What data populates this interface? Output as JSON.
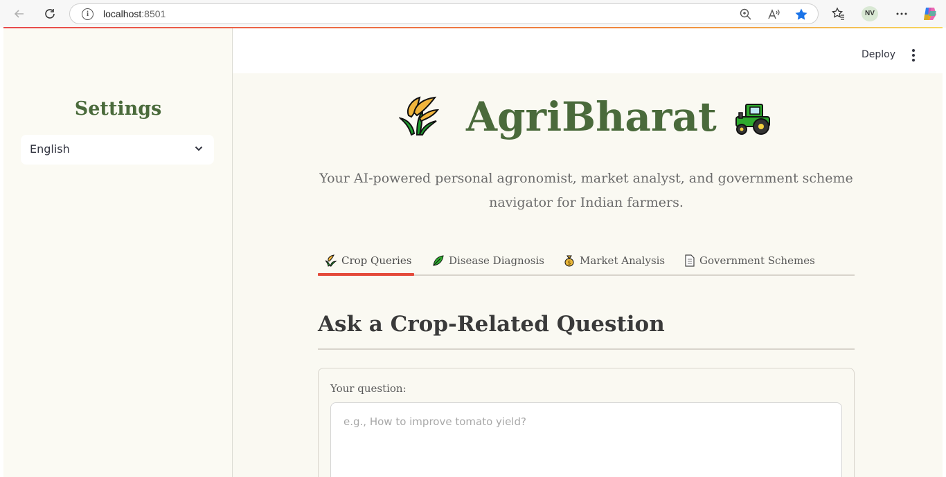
{
  "browser": {
    "url_host": "localhost",
    "url_port": ":8501",
    "profile_initials": "NV"
  },
  "sidebar": {
    "title": "Settings",
    "language_select": {
      "selected": "English"
    }
  },
  "header": {
    "deploy_label": "Deploy"
  },
  "hero": {
    "title": "AgriBharat",
    "subtitle": "Your AI-powered personal agronomist, market analyst, and government scheme navigator for Indian farmers.",
    "left_icon": "wheat-plant-icon",
    "right_icon": "tractor-icon"
  },
  "tabs": [
    {
      "label": "Crop Queries",
      "icon": "crop-icon",
      "active": true
    },
    {
      "label": "Disease Diagnosis",
      "icon": "leaf-icon",
      "active": false
    },
    {
      "label": "Market Analysis",
      "icon": "money-bag-icon",
      "active": false
    },
    {
      "label": "Government Schemes",
      "icon": "document-icon",
      "active": false
    }
  ],
  "section": {
    "title": "Ask a Crop-Related Question",
    "question_label": "Your question:",
    "question_placeholder": "e.g., How to improve tomato yield?",
    "question_value": ""
  },
  "colors": {
    "brand_green": "#4a6a3b",
    "active_tab_underline": "#e44a3a",
    "main_background": "#faf9f2",
    "sidebar_background": "#fbfaf3"
  }
}
